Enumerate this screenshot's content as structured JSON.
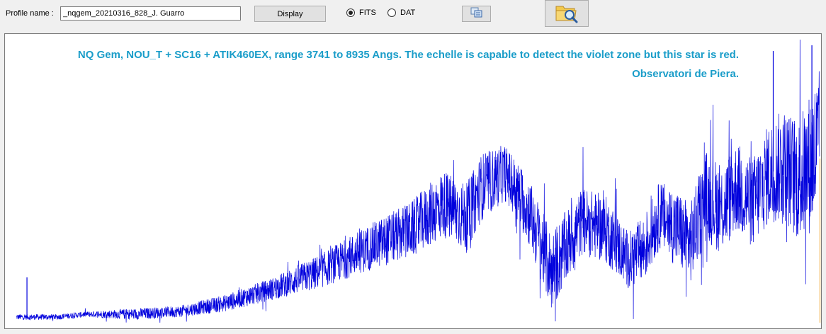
{
  "toolbar": {
    "profile_label": "Profile name :",
    "profile_value": "_nqgem_20210316_828_J. Guarro",
    "display_label": "Display",
    "format_options": [
      {
        "label": "FITS",
        "selected": true
      },
      {
        "label": "DAT",
        "selected": false
      }
    ],
    "copy_icon": "copy-icon",
    "open_icon": "folder-search-icon"
  },
  "plot": {
    "title_line1": "NQ Gem,  NOU_T + SC16 + ATIK460EX, range 3741 to 8935 Angs. The echelle is capable to detect the violet zone but this star is red.",
    "title_line2": "Observatori de Piera.",
    "title_color": "#1a9dc9",
    "line_color": "#0000dd",
    "marker_color": "#f0a020"
  },
  "chart_data": {
    "type": "line",
    "title": "NQ Gem,  NOU_T + SC16 + ATIK460EX, range 3741 to 8935 Angs. The echelle is capable to detect the violet zone but this star is red.",
    "subtitle": "Observatori de Piera.",
    "xlim": [
      3741,
      8935
    ],
    "ylim": [
      0,
      1
    ],
    "grid": false,
    "series": [
      {
        "envelope_x": [
          3741,
          3850,
          4000,
          4200,
          4500,
          4800,
          5100,
          5400,
          5700,
          6000,
          6300,
          6500,
          6650,
          6750,
          6900,
          7050,
          7200,
          7400,
          7550,
          7700,
          7800,
          7900,
          8000,
          8100,
          8200,
          8300,
          8400,
          8500,
          8600,
          8700,
          8800,
          8935
        ],
        "mean": [
          0.02,
          0.02,
          0.02,
          0.03,
          0.03,
          0.04,
          0.07,
          0.12,
          0.18,
          0.26,
          0.33,
          0.42,
          0.37,
          0.48,
          0.53,
          0.4,
          0.18,
          0.36,
          0.33,
          0.22,
          0.26,
          0.38,
          0.34,
          0.28,
          0.45,
          0.4,
          0.48,
          0.42,
          0.52,
          0.56,
          0.5,
          0.62
        ],
        "spread": [
          0.01,
          0.01,
          0.01,
          0.01,
          0.02,
          0.02,
          0.03,
          0.04,
          0.06,
          0.08,
          0.1,
          0.12,
          0.12,
          0.12,
          0.1,
          0.12,
          0.14,
          0.12,
          0.12,
          0.1,
          0.12,
          0.12,
          0.14,
          0.14,
          0.16,
          0.16,
          0.16,
          0.16,
          0.18,
          0.2,
          0.22,
          0.28
        ]
      }
    ],
    "spikes": [
      {
        "x": 3810,
        "y": 0.16
      },
      {
        "x": 8635,
        "y": 0.96
      },
      {
        "x": 8885,
        "y": 0.98
      }
    ]
  }
}
